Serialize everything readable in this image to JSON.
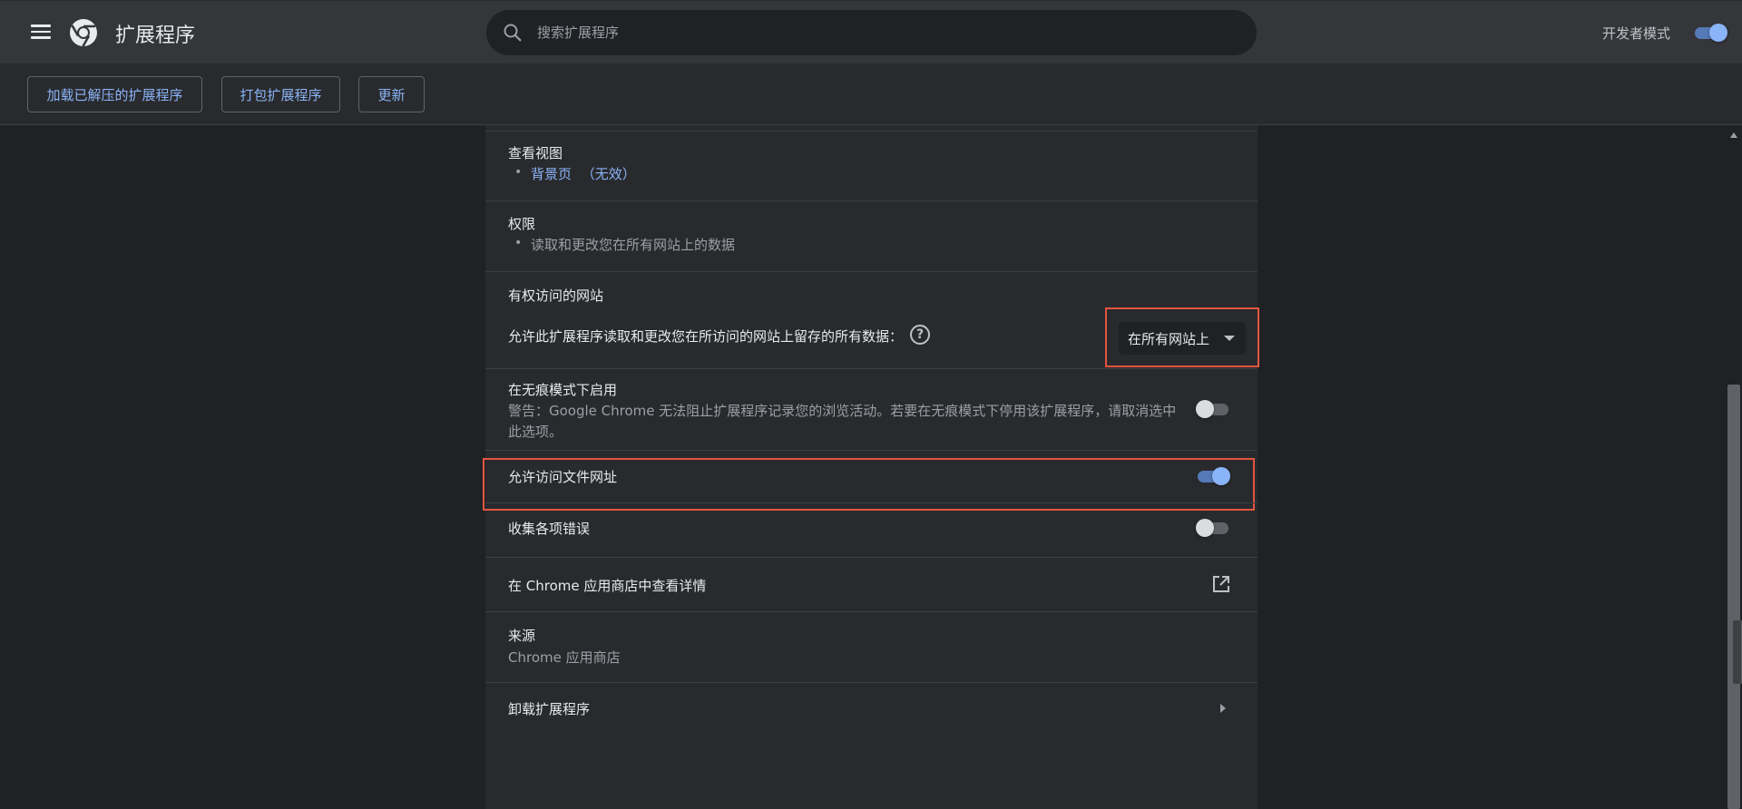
{
  "header": {
    "title": "扩展程序",
    "search_placeholder": "搜索扩展程序",
    "dev_mode_label": "开发者模式",
    "dev_mode_on": true
  },
  "toolbar": {
    "load_unpacked": "加载已解压的扩展程序",
    "pack": "打包扩展程序",
    "update": "更新"
  },
  "details": {
    "views": {
      "title": "查看视图",
      "link": "背景页",
      "status": "（无效）"
    },
    "permissions": {
      "title": "权限",
      "item": "读取和更改您在所有网站上的数据"
    },
    "site_access": {
      "title": "有权访问的网站",
      "description": "允许此扩展程序读取和更改您在所访问的网站上留存的所有数据：",
      "selected": "在所有网站上"
    },
    "incognito": {
      "title": "在无痕模式下启用",
      "warning_line1": "警告：Google Chrome 无法阻止扩展程序记录您的浏览活动。若要在无痕模式下停用该扩展程序，请取消选中",
      "warning_line2": "此选项。",
      "enabled": false
    },
    "file_urls": {
      "title": "允许访问文件网址",
      "enabled": true
    },
    "collect_errors": {
      "title": "收集各项错误",
      "enabled": false
    },
    "webstore": {
      "title": "在 Chrome 应用商店中查看详情"
    },
    "source": {
      "title": "来源",
      "value": "Chrome 应用商店"
    },
    "uninstall": {
      "title": "卸载扩展程序"
    }
  },
  "colors": {
    "accent": "#8ab4f8",
    "highlight": "#e2553f"
  }
}
